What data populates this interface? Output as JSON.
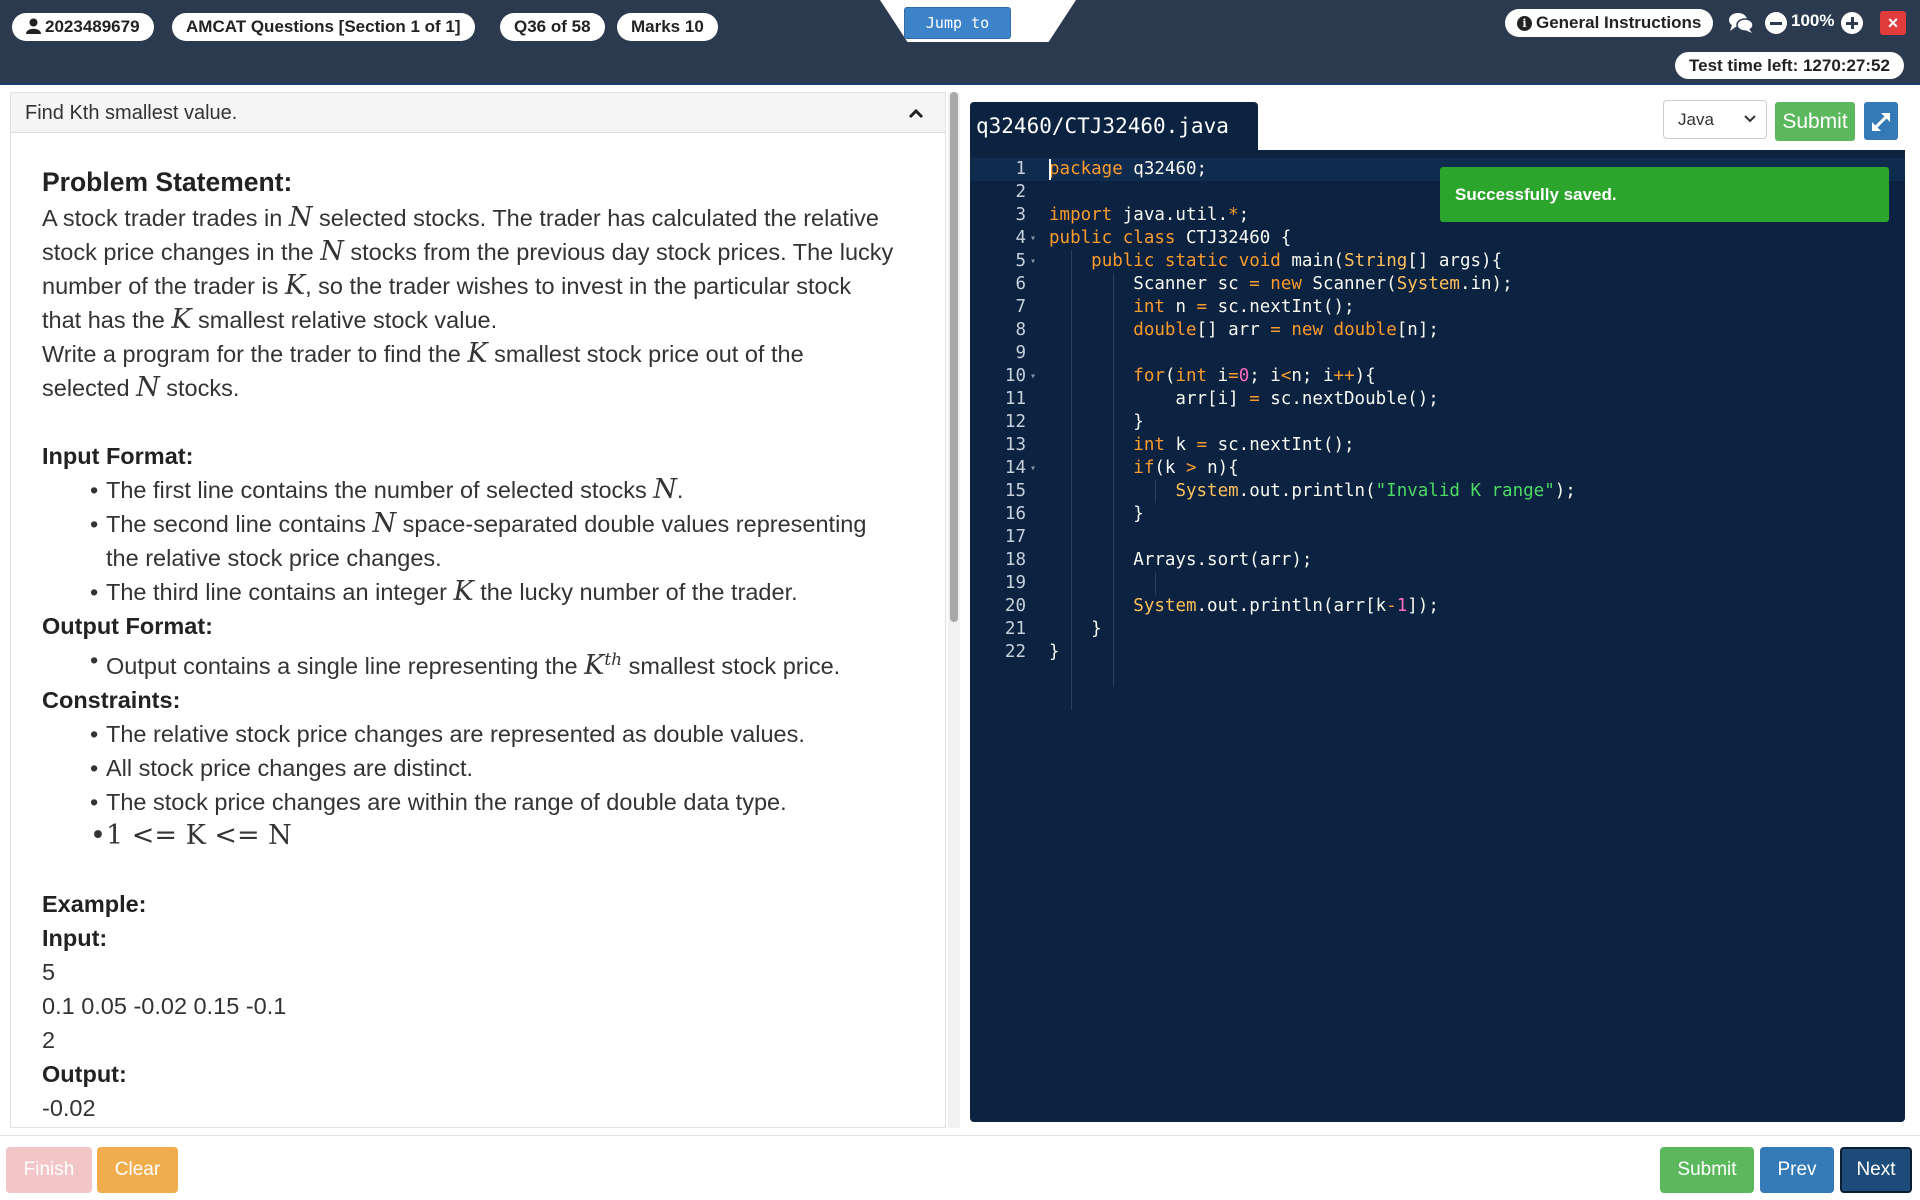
{
  "header": {
    "user_id": "2023489679",
    "section": "AMCAT Questions [Section 1 of 1]",
    "question": "Q36 of 58",
    "marks": "Marks 10",
    "jump_label": "Jump to",
    "instructions_label": "General Instructions",
    "zoom": "100%",
    "close_label": "×",
    "timer": "Test time left: 1270:27:52"
  },
  "problem": {
    "title": "Find Kth smallest value.",
    "statement_heading": "Problem Statement:",
    "statement": [
      [
        "A stock trader trades in ",
        "N",
        " selected stocks. The trader has calculated the relative"
      ],
      [
        "stock price changes in the ",
        "N",
        " stocks from the previous day stock prices. The lucky"
      ],
      [
        "number of the trader is ",
        "K",
        ", so the trader wishes to invest in the particular stock"
      ],
      [
        "that has the ",
        "K",
        " smallest relative stock value."
      ],
      [
        "Write a program for the trader to find the ",
        "K",
        " smallest stock price out of the"
      ],
      [
        "selected ",
        "N",
        " stocks."
      ]
    ],
    "input_heading": "Input Format:",
    "input_items": [
      [
        "The first line contains the number of selected stocks ",
        "N",
        "."
      ],
      [
        "The second line contains ",
        "N",
        " space-separated double values representing"
      ],
      [
        "",
        "",
        "the relative stock price changes."
      ],
      [
        "The third line contains an integer ",
        "K",
        " the lucky number of the trader."
      ]
    ],
    "output_heading": "Output Format:",
    "output_items": [
      [
        "Output contains a single line representing the ",
        "K",
        "th",
        " smallest stock price."
      ]
    ],
    "constraints_heading": "Constraints:",
    "constraints": [
      "The relative stock price changes are represented as double values.",
      "All stock price changes are distinct.",
      "The stock price changes are within the range of double data type.",
      "1 <= K <= N"
    ],
    "example_heading": "Example:",
    "example_input_label": "Input:",
    "example_input_lines": [
      "5",
      "0.1 0.05 -0.02 0.15 -0.1",
      "2"
    ],
    "example_output_label": "Output:",
    "example_output_lines": [
      "-0.02"
    ]
  },
  "editor": {
    "file_name": "q32460/CTJ32460.java",
    "language": "Java",
    "submit_label": "Submit",
    "toast": "Successfully saved.",
    "line_numbers": [
      "1",
      "2",
      "3",
      "4",
      "5",
      "6",
      "7",
      "8",
      "9",
      "10",
      "11",
      "12",
      "13",
      "14",
      "15",
      "16",
      "17",
      "18",
      "19",
      "20",
      "21",
      "22"
    ],
    "code_lines": [
      "package q32460;",
      "",
      "import java.util.*;",
      "public class CTJ32460 {",
      "    public static void main(String[] args){",
      "        Scanner sc = new Scanner(System.in);",
      "        int n = sc.nextInt();",
      "        double[] arr = new double[n];",
      "",
      "        for(int i=0; i<n; i++){",
      "            arr[i] = sc.nextDouble();",
      "        }",
      "        int k = sc.nextInt();",
      "        if(k > n){",
      "            System.out.println(\"Invalid K range\");",
      "        }",
      "",
      "        Arrays.sort(arr);",
      "",
      "        System.out.println(arr[k-1]);",
      "    }",
      "}"
    ]
  },
  "footer": {
    "finish_label": "Finish",
    "clear_label": "Clear",
    "submit_label": "Submit",
    "prev_label": "Prev",
    "next_label": "Next"
  }
}
